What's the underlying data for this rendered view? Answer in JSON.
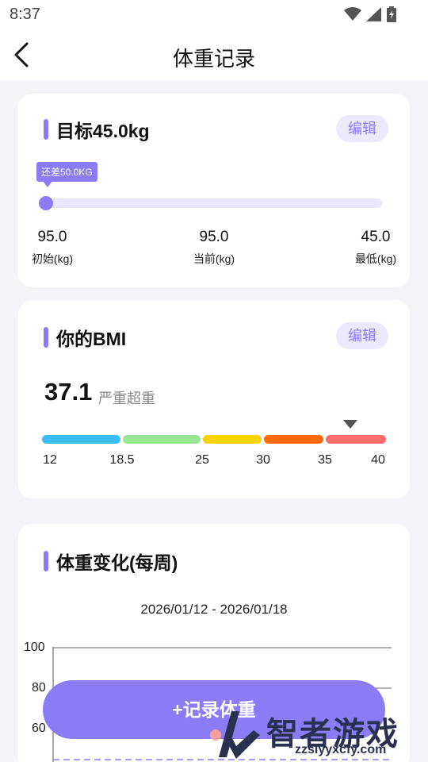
{
  "status_bar": {
    "time": "8:37"
  },
  "header": {
    "title": "体重记录"
  },
  "goal_card": {
    "title": "目标45.0kg",
    "edit_label": "编辑",
    "tooltip": "还差50.0KG",
    "progress_fraction": 0.0,
    "stats": [
      {
        "value": "95.0",
        "label": "初始(kg)"
      },
      {
        "value": "95.0",
        "label": "当前(kg)"
      },
      {
        "value": "45.0",
        "label": "最低(kg)"
      }
    ]
  },
  "bmi_card": {
    "title": "你的BMI",
    "edit_label": "编辑",
    "value": "37.1",
    "status": "严重超重",
    "scale": [
      "12",
      "18.5",
      "25",
      "30",
      "35",
      "40"
    ],
    "segment_colors": [
      "#3bbcf7",
      "#98e593",
      "#fbd300",
      "#ff6b0a",
      "#ff6d6d"
    ]
  },
  "chart_card": {
    "title": "体重变化(每周)",
    "date_range": "2026/01/12 - 2026/01/18"
  },
  "chart_data": {
    "type": "line",
    "title": "",
    "y_ticks": [
      "100",
      "80",
      "60"
    ],
    "ylim": [
      40,
      100
    ],
    "grid": true,
    "target_line": 45
  },
  "record_button": {
    "label": "+记录体重"
  },
  "watermark": {
    "text": "智者游戏网",
    "url": "zzsiyyxcfy.com"
  },
  "colors": {
    "accent": "#8b7cf6",
    "accent_light": "#ece9fd",
    "background": "#f4f4f8"
  }
}
